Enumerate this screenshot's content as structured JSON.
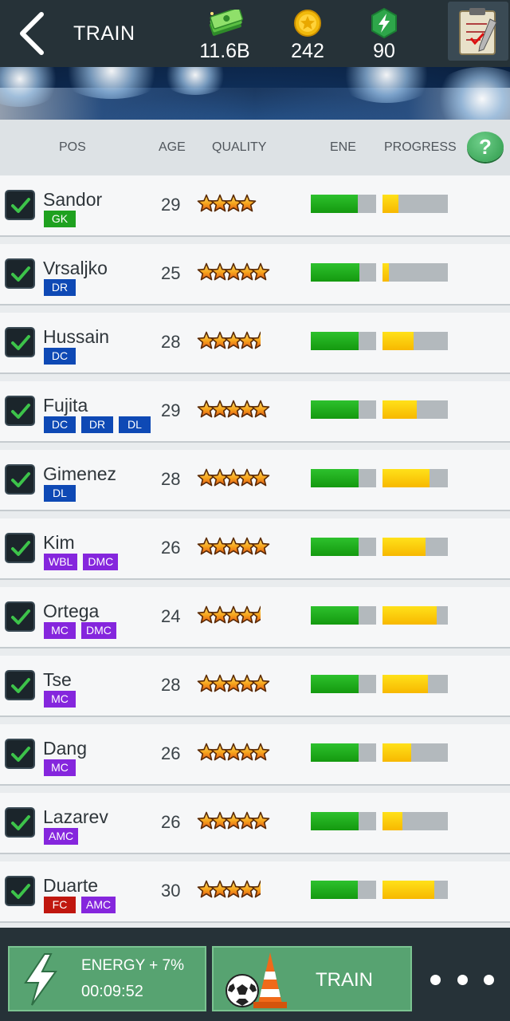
{
  "topbar": {
    "title": "TRAIN",
    "cash": "11.6B",
    "coins": "242",
    "energy": "90",
    "icons": {
      "back": "back-chevron-icon",
      "cash": "money-stack-icon",
      "coins": "gold-coin-icon",
      "energy": "energy-bolt-icon",
      "clipboard": "clipboard-icon"
    }
  },
  "columns": {
    "pos": "POS",
    "age": "AGE",
    "quality": "QUALITY",
    "energy": "ENE",
    "progress": "PROGRESS",
    "help": "?"
  },
  "colors": {
    "GK": "#1fa11f",
    "DR": "#0e49b5",
    "DC": "#0e49b5",
    "DL": "#0e49b5",
    "WBL": "#8526dd",
    "DMC": "#8526dd",
    "MC": "#8526dd",
    "AMC": "#8526dd",
    "FC": "#c0170f"
  },
  "players": [
    {
      "name": "Sandor",
      "age": "29",
      "positions": [
        "GK"
      ],
      "stars": 4,
      "energy": 0.72,
      "progress": 0.24
    },
    {
      "name": "Vrsaljko",
      "age": "25",
      "positions": [
        "DR"
      ],
      "stars": 5,
      "energy": 0.74,
      "progress": 0.1
    },
    {
      "name": "Hussain",
      "age": "28",
      "positions": [
        "DC"
      ],
      "stars": 4.5,
      "energy": 0.73,
      "progress": 0.48
    },
    {
      "name": "Fujita",
      "age": "29",
      "positions": [
        "DC",
        "DR",
        "DL"
      ],
      "stars": 5,
      "energy": 0.73,
      "progress": 0.53
    },
    {
      "name": "Gimenez",
      "age": "28",
      "positions": [
        "DL"
      ],
      "stars": 5,
      "energy": 0.73,
      "progress": 0.72
    },
    {
      "name": "Kim",
      "age": "26",
      "positions": [
        "WBL",
        "DMC"
      ],
      "stars": 5,
      "energy": 0.73,
      "progress": 0.66
    },
    {
      "name": "Ortega",
      "age": "24",
      "positions": [
        "MC",
        "DMC"
      ],
      "stars": 4.5,
      "energy": 0.73,
      "progress": 0.83
    },
    {
      "name": "Tse",
      "age": "28",
      "positions": [
        "MC"
      ],
      "stars": 5,
      "energy": 0.73,
      "progress": 0.7
    },
    {
      "name": "Dang",
      "age": "26",
      "positions": [
        "MC"
      ],
      "stars": 5,
      "energy": 0.73,
      "progress": 0.44
    },
    {
      "name": "Lazarev",
      "age": "26",
      "positions": [
        "AMC"
      ],
      "stars": 5,
      "energy": 0.73,
      "progress": 0.31
    },
    {
      "name": "Duarte",
      "age": "30",
      "positions": [
        "FC",
        "AMC"
      ],
      "stars": 4.5,
      "energy": 0.72,
      "progress": 0.79
    }
  ],
  "bottom": {
    "energy_button": {
      "title": "ENERGY + 7%",
      "timer": "00:09:52",
      "icon": "lightning-icon"
    },
    "train_button": {
      "label": "TRAIN",
      "icons": [
        "soccer-ball-icon",
        "training-cone-icon"
      ]
    },
    "more": "more-dots-icon"
  }
}
